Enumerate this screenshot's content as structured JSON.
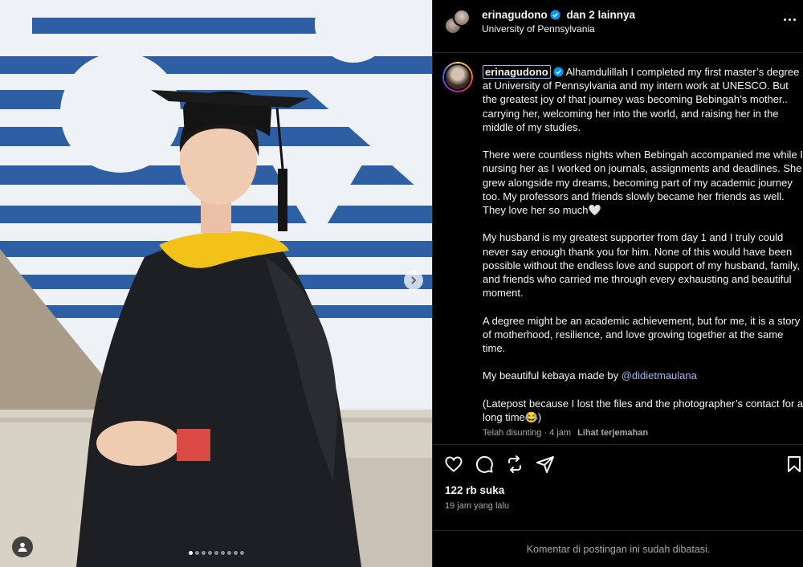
{
  "post": {
    "author": "erinagudono",
    "co_authors": "dan 2 lainnya",
    "location": "University of Pennsylvania"
  },
  "caption": {
    "username": "erinagudono",
    "p1": "Alhamdulillah I completed my first master’s degree at University of Pennsylvania and my intern work at UNESCO. But the greatest joy of that journey was becoming Bebingah’s mother.. carrying her, welcoming her into the world, and raising her in the middle of my studies.",
    "p2": "There were countless nights when Bebingah accompanied me while I nursing her as I worked on journals, assignments and deadlines. She grew alongside my dreams, becoming part of my academic journey too. My professors and friends slowly became her friends as well. They love her so much🤍",
    "p3": "My husband is my greatest supporter from day 1 and I truly could never say enough thank you for him. None of this would have been possible without the endless love and support of my husband, family, and friends who carried me through every exhausting and beautiful moment.",
    "p4": "A degree might be an academic achievement, but for me, it is a story of motherhood, resilience, and love growing together at the same time.",
    "p5_prefix": "My beautiful kebaya made by ",
    "p5_mention": "@didietmaulana",
    "p6": "(Latepost because I lost the files and the photographer’s contact for a long time😂)",
    "edited": "Telah disunting · 4 jam",
    "translate": "Lihat terjemahan"
  },
  "stats": {
    "likes": "122 rb suka",
    "time_ago": "19 jam yang lalu"
  },
  "comments_notice": "Komentar di postingan ini sudah dibatasi.",
  "carousel": {
    "slides": 9,
    "active_index": 0
  },
  "icons": [
    "verified-badge-icon",
    "more-options-icon",
    "heart-icon",
    "comment-icon",
    "repost-icon",
    "share-icon",
    "bookmark-icon",
    "chevron-right-icon",
    "user-tag-icon"
  ],
  "colors": {
    "background": "#000000",
    "text": "#f5f5f5",
    "muted": "#a8a8a8",
    "verified": "#0095f6",
    "mention": "#a7b6f4"
  }
}
